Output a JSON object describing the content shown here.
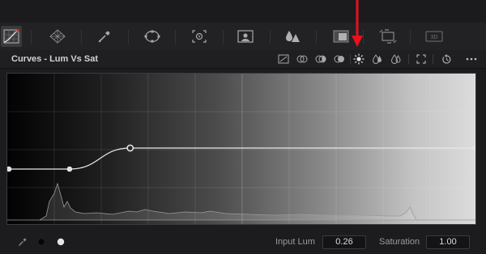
{
  "toolbar": {
    "tools": [
      {
        "icon": "curves-icon",
        "active": true
      },
      {
        "icon": "color-warper-icon",
        "active": false
      },
      {
        "icon": "qualifier-picker-icon",
        "active": false
      },
      {
        "icon": "window-icon",
        "active": false
      },
      {
        "icon": "tracker-icon",
        "active": false
      },
      {
        "icon": "magic-mask-icon",
        "active": false
      },
      {
        "icon": "blur-icon",
        "active": false
      },
      {
        "icon": "key-icon",
        "active": false
      },
      {
        "icon": "sizing-icon",
        "active": false
      },
      {
        "icon": "3d-icon",
        "active": false
      }
    ]
  },
  "panel": {
    "title": "Curves - Lum Vs Sat",
    "header_icons": [
      "custom-curve-icon",
      "hue-vs-hue-icon",
      "hue-vs-sat-icon",
      "hue-vs-lum-icon",
      "lum-vs-sat-icon",
      "sat-vs-sat-icon",
      "sat-vs-lum-icon",
      "expand-icon",
      "reset-icon",
      "more-options-icon"
    ]
  },
  "curve": {
    "points": [
      {
        "input_lum": 0.0,
        "saturation": 0.5
      },
      {
        "input_lum": 0.13,
        "saturation": 0.5
      },
      {
        "input_lum": 0.26,
        "saturation": 1.0
      },
      {
        "input_lum": 1.0,
        "saturation": 1.0
      }
    ],
    "selected_index": 2
  },
  "footer": {
    "picker_icon": "eyedropper-icon",
    "black_point_icon": "black-dot-icon",
    "white_point_icon": "white-dot-icon",
    "input_lum_label": "Input Lum",
    "input_lum_value": "0.26",
    "saturation_label": "Saturation",
    "saturation_value": "1.00"
  },
  "annotation": {
    "color": "#e8101a"
  }
}
